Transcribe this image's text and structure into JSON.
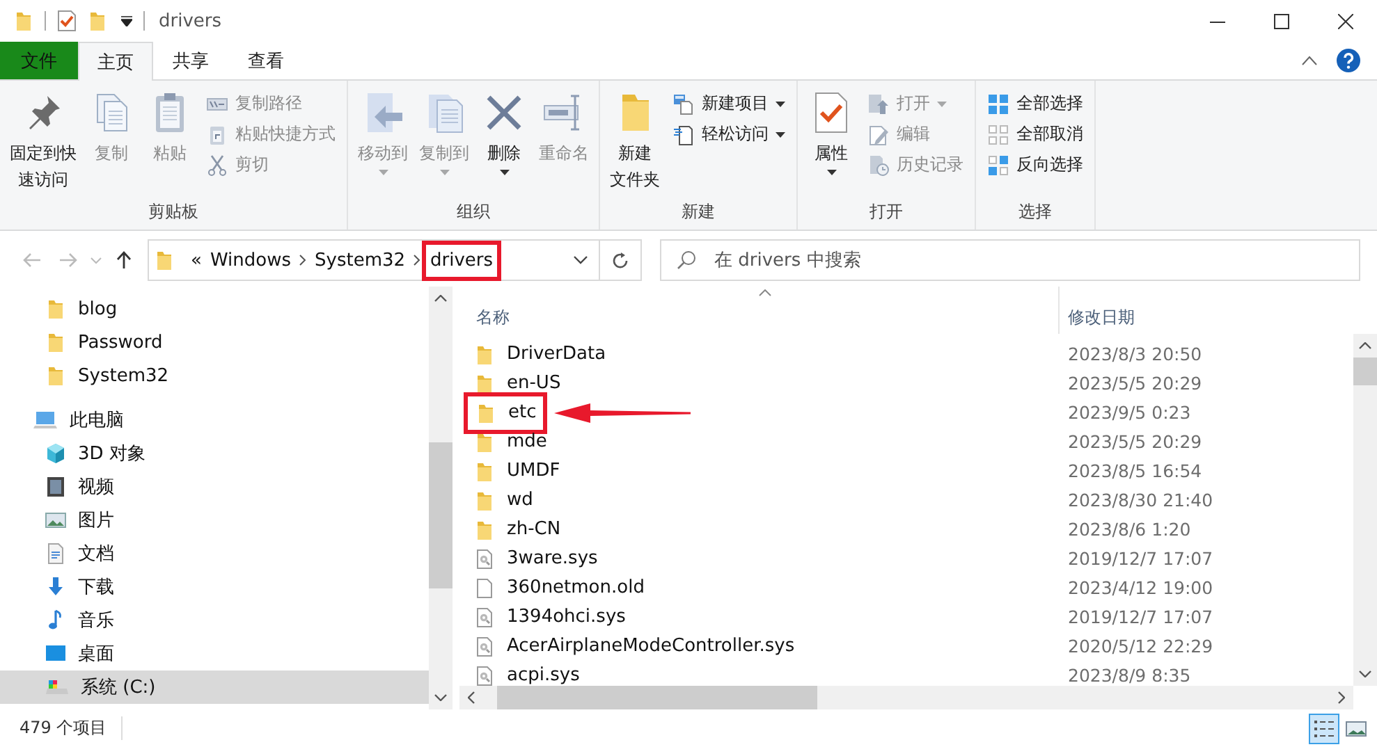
{
  "window": {
    "title": "drivers"
  },
  "ribbon_tabs": [
    {
      "label": "文件",
      "kind": "file",
      "selected": false
    },
    {
      "label": "主页",
      "kind": "tab",
      "selected": true
    },
    {
      "label": "共享",
      "kind": "tab",
      "selected": false
    },
    {
      "label": "查看",
      "kind": "tab",
      "selected": false
    }
  ],
  "ribbon_groups": [
    {
      "label": "剪贴板",
      "items": [
        {
          "label_lines": [
            "固定到快",
            "速访问"
          ],
          "kind": "large",
          "disabled": false,
          "dropdown": false
        },
        {
          "label": "复制",
          "kind": "large",
          "disabled": true,
          "dropdown": false
        },
        {
          "label": "粘贴",
          "kind": "large",
          "disabled": true,
          "dropdown": false
        },
        {
          "label": "复制路径",
          "kind": "small",
          "disabled": true,
          "dropdown": false
        },
        {
          "label": "粘贴快捷方式",
          "kind": "small",
          "disabled": true,
          "dropdown": false
        },
        {
          "label": "剪切",
          "kind": "small",
          "disabled": true,
          "dropdown": false
        }
      ]
    },
    {
      "label": "组织",
      "items": [
        {
          "label": "移动到",
          "kind": "large",
          "disabled": true,
          "dropdown": true
        },
        {
          "label": "复制到",
          "kind": "large",
          "disabled": true,
          "dropdown": true
        },
        {
          "label": "删除",
          "kind": "large",
          "disabled": false,
          "dropdown": true
        },
        {
          "label": "重命名",
          "kind": "large",
          "disabled": true,
          "dropdown": false
        }
      ]
    },
    {
      "label": "新建",
      "items": [
        {
          "label_lines": [
            "新建",
            "文件夹"
          ],
          "kind": "large",
          "disabled": false,
          "dropdown": false
        },
        {
          "label": "新建项目",
          "kind": "small",
          "disabled": false,
          "dropdown": true
        },
        {
          "label": "轻松访问",
          "kind": "small",
          "disabled": false,
          "dropdown": true
        }
      ]
    },
    {
      "label": "打开",
      "items": [
        {
          "label": "属性",
          "kind": "large",
          "disabled": false,
          "dropdown": true
        },
        {
          "label": "打开",
          "kind": "small",
          "disabled": true,
          "dropdown": true
        },
        {
          "label": "编辑",
          "kind": "small",
          "disabled": true,
          "dropdown": false
        },
        {
          "label": "历史记录",
          "kind": "small",
          "disabled": true,
          "dropdown": false
        }
      ]
    },
    {
      "label": "选择",
      "items": [
        {
          "label": "全部选择",
          "kind": "small",
          "disabled": false,
          "dropdown": false
        },
        {
          "label": "全部取消",
          "kind": "small",
          "disabled": false,
          "dropdown": false
        },
        {
          "label": "反向选择",
          "kind": "small",
          "disabled": false,
          "dropdown": false
        }
      ]
    }
  ],
  "address_bar": {
    "overflow": "«",
    "crumbs": [
      {
        "label": "Windows",
        "highlighted": false
      },
      {
        "label": "System32",
        "highlighted": false
      },
      {
        "label": "drivers",
        "highlighted": true
      }
    ]
  },
  "search": {
    "placeholder": "在 drivers 中搜索"
  },
  "nav_pane": {
    "quick_access_items": [
      {
        "label": "blog",
        "kind": "folder",
        "selected": false
      },
      {
        "label": "Password",
        "kind": "folder",
        "selected": false
      },
      {
        "label": "System32",
        "kind": "folder",
        "selected": false
      }
    ],
    "this_pc": {
      "label": "此电脑",
      "kind": "pc",
      "selected": false,
      "children": [
        {
          "label": "3D 对象",
          "kind": "cube",
          "selected": false
        },
        {
          "label": "视频",
          "kind": "video",
          "selected": false
        },
        {
          "label": "图片",
          "kind": "picture",
          "selected": false
        },
        {
          "label": "文档",
          "kind": "document",
          "selected": false
        },
        {
          "label": "下载",
          "kind": "download",
          "selected": false
        },
        {
          "label": "音乐",
          "kind": "music",
          "selected": false
        },
        {
          "label": "桌面",
          "kind": "desktop",
          "selected": false
        },
        {
          "label": "系统 (C:)",
          "kind": "drive",
          "selected": true
        }
      ]
    }
  },
  "file_list": {
    "columns": [
      {
        "label": "名称",
        "sorted": true
      },
      {
        "label": "修改日期",
        "sorted": false
      }
    ],
    "rows": [
      {
        "name": "DriverData",
        "kind": "folder",
        "modified": "2023/8/3 20:50",
        "highlighted": false
      },
      {
        "name": "en-US",
        "kind": "folder",
        "modified": "2023/5/5 20:29",
        "highlighted": false
      },
      {
        "name": "etc",
        "kind": "folder",
        "modified": "2023/9/5 0:23",
        "highlighted": true
      },
      {
        "name": "mde",
        "kind": "folder",
        "modified": "2023/5/5 20:29",
        "highlighted": false
      },
      {
        "name": "UMDF",
        "kind": "folder",
        "modified": "2023/8/5 16:54",
        "highlighted": false
      },
      {
        "name": "wd",
        "kind": "folder",
        "modified": "2023/8/30 21:40",
        "highlighted": false
      },
      {
        "name": "zh-CN",
        "kind": "folder",
        "modified": "2023/8/6 1:20",
        "highlighted": false
      },
      {
        "name": "3ware.sys",
        "kind": "sys",
        "modified": "2019/12/7 17:07",
        "highlighted": false
      },
      {
        "name": "360netmon.old",
        "kind": "file",
        "modified": "2023/4/12 19:00",
        "highlighted": false
      },
      {
        "name": "1394ohci.sys",
        "kind": "sys",
        "modified": "2019/12/7 17:07",
        "highlighted": false
      },
      {
        "name": "AcerAirplaneModeController.sys",
        "kind": "sys",
        "modified": "2020/5/12 22:29",
        "highlighted": false
      },
      {
        "name": "acpi.sys",
        "kind": "sys",
        "modified": "2023/8/9 8:35",
        "highlighted": false
      }
    ]
  },
  "status_bar": {
    "item_count": "479 个项目",
    "views": [
      {
        "kind": "details",
        "selected": true
      },
      {
        "kind": "large-icons",
        "selected": false
      }
    ]
  }
}
